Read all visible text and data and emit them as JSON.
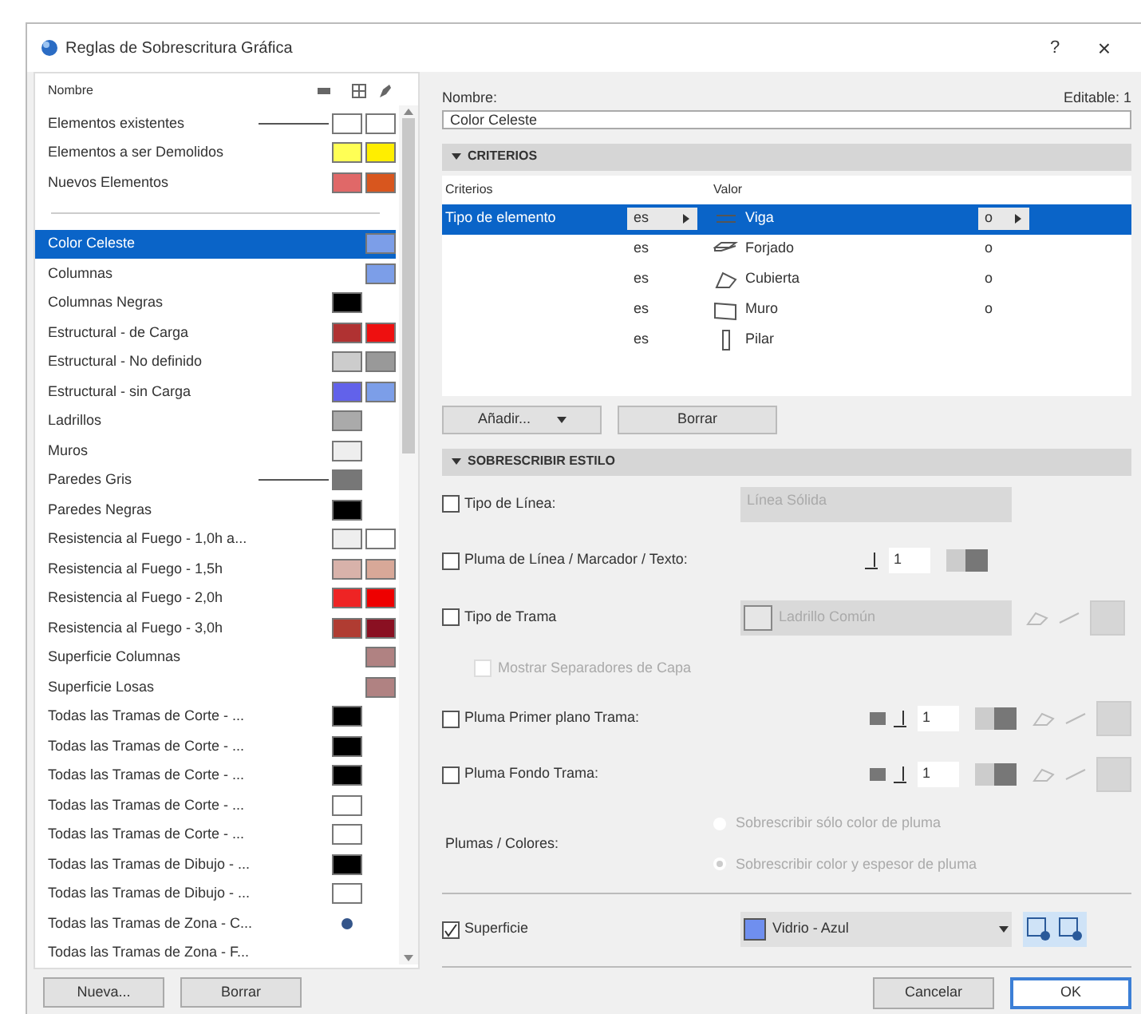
{
  "window": {
    "title": "Reglas de Sobrescritura Gráfica",
    "help": "?",
    "close": "×"
  },
  "rules_list": {
    "header": "Nombre",
    "pinned": [
      {
        "name": "Elementos existentes",
        "leader": true,
        "swatches": [
          {
            "kind": "fill",
            "color": "#ffffff"
          },
          {
            "kind": "surface",
            "color": "#ffffff"
          }
        ]
      },
      {
        "name": "Elementos a ser Demolidos",
        "leader": false,
        "swatches": [
          {
            "kind": "fill",
            "color": "#ffff55"
          },
          {
            "kind": "surface",
            "color": "#ffee00"
          }
        ]
      },
      {
        "name": "Nuevos Elementos",
        "leader": false,
        "swatches": [
          {
            "kind": "fill",
            "color": "#e06868"
          },
          {
            "kind": "surface",
            "color": "#d8561e"
          }
        ]
      }
    ],
    "items": [
      {
        "name": "Color Celeste",
        "selected": true,
        "leader": false,
        "swatches": [
          {
            "kind": "surface",
            "color": "#7c9ee8"
          }
        ]
      },
      {
        "name": "Columnas",
        "selected": false,
        "leader": false,
        "swatches": [
          {
            "kind": "surface",
            "color": "#7c9ee8"
          }
        ]
      },
      {
        "name": "Columnas Negras",
        "selected": false,
        "leader": false,
        "swatches": [
          {
            "kind": "fill",
            "color": "#000000"
          }
        ]
      },
      {
        "name": "Estructural - de Carga",
        "selected": false,
        "leader": false,
        "swatches": [
          {
            "kind": "fill",
            "color": "#b03232"
          },
          {
            "kind": "surface",
            "color": "#ee1010"
          }
        ]
      },
      {
        "name": "Estructural - No definido",
        "selected": false,
        "leader": false,
        "swatches": [
          {
            "kind": "fill",
            "color": "#cccccc"
          },
          {
            "kind": "surface",
            "color": "#999999"
          }
        ]
      },
      {
        "name": "Estructural - sin Carga",
        "selected": false,
        "leader": false,
        "swatches": [
          {
            "kind": "fill",
            "color": "#6262ea"
          },
          {
            "kind": "surface",
            "color": "#7c9ee8"
          }
        ]
      },
      {
        "name": "Ladrillos",
        "selected": false,
        "leader": false,
        "swatches": [
          {
            "kind": "fill",
            "color": "#aaaaaa"
          }
        ]
      },
      {
        "name": "Muros",
        "selected": false,
        "leader": false,
        "swatches": [
          {
            "kind": "fill",
            "color": "#eeeeee"
          }
        ]
      },
      {
        "name": "Paredes Gris",
        "selected": false,
        "leader": true,
        "swatches": [
          {
            "kind": "fill",
            "color": "#777777"
          }
        ]
      },
      {
        "name": "Paredes Negras",
        "selected": false,
        "leader": false,
        "swatches": [
          {
            "kind": "fill",
            "color": "#000000"
          }
        ]
      },
      {
        "name": "Resistencia al Fuego - 1,0h a...",
        "selected": false,
        "leader": false,
        "swatches": [
          {
            "kind": "fill",
            "color": "#eeeeee"
          },
          {
            "kind": "surface",
            "color": "#ffffff"
          }
        ]
      },
      {
        "name": "Resistencia al Fuego - 1,5h",
        "selected": false,
        "leader": false,
        "swatches": [
          {
            "kind": "fill",
            "color": "#d8b2aa"
          },
          {
            "kind": "surface",
            "color": "#d8a898"
          }
        ]
      },
      {
        "name": "Resistencia al Fuego - 2,0h",
        "selected": false,
        "leader": false,
        "swatches": [
          {
            "kind": "fill",
            "color": "#ee2424"
          },
          {
            "kind": "surface",
            "color": "#ee0000"
          }
        ]
      },
      {
        "name": "Resistencia al Fuego - 3,0h",
        "selected": false,
        "leader": false,
        "swatches": [
          {
            "kind": "fill",
            "color": "#b03c32"
          },
          {
            "kind": "surface",
            "color": "#8a1022"
          }
        ]
      },
      {
        "name": "Superficie Columnas",
        "selected": false,
        "leader": false,
        "swatches": [
          {
            "kind": "surface",
            "color": "#b08282"
          }
        ]
      },
      {
        "name": "Superficie Losas",
        "selected": false,
        "leader": false,
        "swatches": [
          {
            "kind": "surface",
            "color": "#b08282"
          }
        ]
      },
      {
        "name": "Todas las Tramas de Corte - ...",
        "selected": false,
        "leader": false,
        "swatches": [
          {
            "kind": "fill",
            "color": "#000000"
          }
        ]
      },
      {
        "name": "Todas las Tramas de Corte - ...",
        "selected": false,
        "leader": false,
        "swatches": [
          {
            "kind": "fill",
            "color": "#000000"
          }
        ]
      },
      {
        "name": "Todas las Tramas de Corte - ...",
        "selected": false,
        "leader": false,
        "swatches": [
          {
            "kind": "fill",
            "color": "#000000"
          }
        ]
      },
      {
        "name": "Todas las Tramas de Corte - ...",
        "selected": false,
        "leader": false,
        "swatches": [
          {
            "kind": "fill",
            "color": "#ffffff"
          }
        ]
      },
      {
        "name": "Todas las Tramas de Corte - ...",
        "selected": false,
        "leader": false,
        "swatches": [
          {
            "kind": "fill",
            "color": "#ffffff"
          }
        ]
      },
      {
        "name": "Todas las Tramas de Dibujo - ...",
        "selected": false,
        "leader": false,
        "swatches": [
          {
            "kind": "fill",
            "color": "#000000"
          }
        ]
      },
      {
        "name": "Todas las Tramas de Dibujo - ...",
        "selected": false,
        "leader": false,
        "swatches": [
          {
            "kind": "fill",
            "color": "#ffffff"
          }
        ]
      },
      {
        "name": "Todas las Tramas de Zona - C...",
        "selected": false,
        "leader": false,
        "swatches": [
          {
            "kind": "dot",
            "color": "#34558a"
          }
        ]
      },
      {
        "name": "Todas las Tramas de Zona - F...",
        "selected": false,
        "leader": false
      }
    ],
    "buttons": [
      "Nueva...",
      "Borrar"
    ]
  },
  "editor": {
    "name_label": "Nombre:",
    "editable": "Editable: 1",
    "name_value": "Color Celeste",
    "criteria": {
      "title": "CRITERIOS",
      "expanded": true,
      "columns": [
        "Criterios",
        "Valor"
      ],
      "rows": [
        {
          "criterion": "Tipo de elemento",
          "operator": "es",
          "value": "Viga",
          "joiner": "o",
          "selected": true
        },
        {
          "operator": "es",
          "value": "Forjado",
          "joiner": "o",
          "selected": false
        },
        {
          "operator": "es",
          "value": "Cubierta",
          "joiner": "o",
          "selected": false
        },
        {
          "operator": "es",
          "value": "Muro",
          "joiner": "o",
          "selected": false
        },
        {
          "operator": "es",
          "value": "Pilar",
          "selected": false
        }
      ],
      "buttons": [
        {
          "label": "Añadir...",
          "dropdown": true
        },
        {
          "label": "Borrar",
          "dropdown": false
        }
      ]
    },
    "override": {
      "title": "SOBRESCRIBIR ESTILO",
      "expanded": true,
      "rows": [
        {
          "kind": "select",
          "label": "Tipo de Línea:",
          "checked": false,
          "value": "Línea Sólida"
        },
        {
          "kind": "pen",
          "label": "Pluma de Línea / Marcador / Texto:",
          "checked": false,
          "value": "1"
        },
        {
          "kind": "fill",
          "label": "Tipo de Trama",
          "checked": false,
          "value": "Ladrillo Común"
        },
        {
          "kind": "subcheck",
          "label": "Mostrar Separadores de Capa",
          "checked": false,
          "disabled": true
        },
        {
          "kind": "fillpen",
          "label": "Pluma Primer plano Trama:",
          "checked": false,
          "value": "1"
        },
        {
          "kind": "fillpen",
          "label": "Pluma Fondo Trama:",
          "checked": false,
          "value": "1"
        },
        {
          "kind": "radios",
          "label": "Plumas / Colores:",
          "options": [
            {
              "label": "Sobrescribir sólo color de pluma",
              "selected": false
            },
            {
              "label": "Sobrescribir color y espesor de pluma",
              "selected": true
            }
          ],
          "disabled": true
        },
        {
          "kind": "surface",
          "label": "Superficie",
          "checked": true,
          "value": "Vidrio - Azul",
          "color": "#6f8fef"
        }
      ]
    }
  },
  "footer": {
    "buttons": [
      "Cancelar",
      "OK"
    ]
  }
}
